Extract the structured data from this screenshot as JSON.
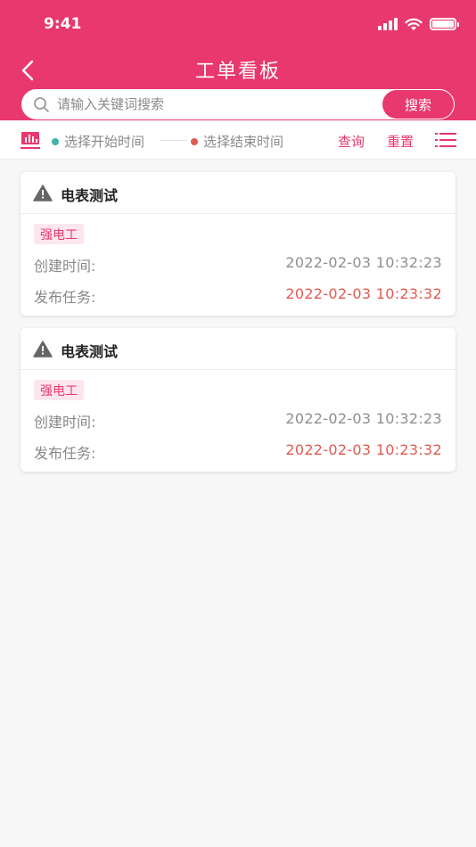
{
  "status_bar": {
    "time": "9:41"
  },
  "header": {
    "title": "工单看板"
  },
  "search": {
    "placeholder": "请输入关键词搜索",
    "value": "",
    "button_label": "搜索"
  },
  "filter": {
    "start_label": "选择开始时间",
    "end_label": "选择结束时间",
    "query_label": "查询",
    "reset_label": "重置"
  },
  "colors": {
    "accent": "#e9386e",
    "start_dot": "#3fb5a8",
    "end_dot": "#e25b51",
    "tag_bg": "#fde6ee"
  },
  "cards": [
    {
      "title": "电表测试",
      "tag": "强电工",
      "created_label": "创建时间:",
      "created_value": "2022-02-03 10:32:23",
      "publish_label": "发布任务:",
      "publish_value": "2022-02-03 10:23:32"
    },
    {
      "title": "电表测试",
      "tag": "强电工",
      "created_label": "创建时间:",
      "created_value": "2022-02-03 10:32:23",
      "publish_label": "发布任务:",
      "publish_value": "2022-02-03 10:23:32"
    }
  ]
}
